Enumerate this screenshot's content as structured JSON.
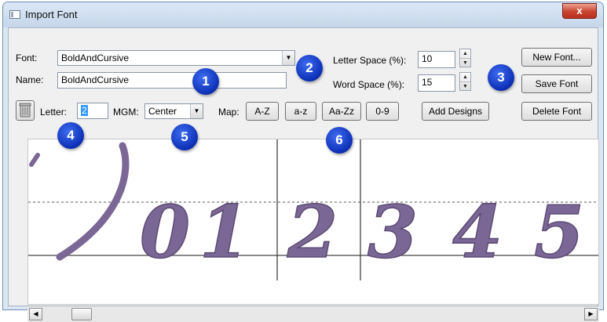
{
  "window": {
    "title": "Import Font",
    "close_label": "x"
  },
  "form": {
    "font_label": "Font:",
    "font_value": "BoldAndCursive",
    "name_label": "Name:",
    "name_value": "BoldAndCursive",
    "letter_space_label": "Letter Space (%):",
    "letter_space_value": "10",
    "word_space_label": "Word Space (%):",
    "word_space_value": "15",
    "letter_label": "Letter:",
    "letter_value": "2",
    "mgm_label": "MGM:",
    "mgm_value": "Center",
    "map_label": "Map:"
  },
  "buttons": {
    "new_font": "New Font...",
    "save_font": "Save Font",
    "delete_font": "Delete Font",
    "add_designs": "Add Designs",
    "map_az_upper": "A-Z",
    "map_az_lower": "a-z",
    "map_aazz": "Aa-Zz",
    "map_09": "0-9"
  },
  "callouts": [
    "1",
    "2",
    "3",
    "4",
    "5",
    "6"
  ],
  "preview": {
    "glyphs": [
      "0",
      "1",
      "2",
      "3",
      "4",
      "5"
    ],
    "glyph_color": "#7b6796"
  },
  "colors": {
    "badge": "#0f34c0",
    "title_bar": "#cfdced",
    "close": "#c8432d"
  }
}
